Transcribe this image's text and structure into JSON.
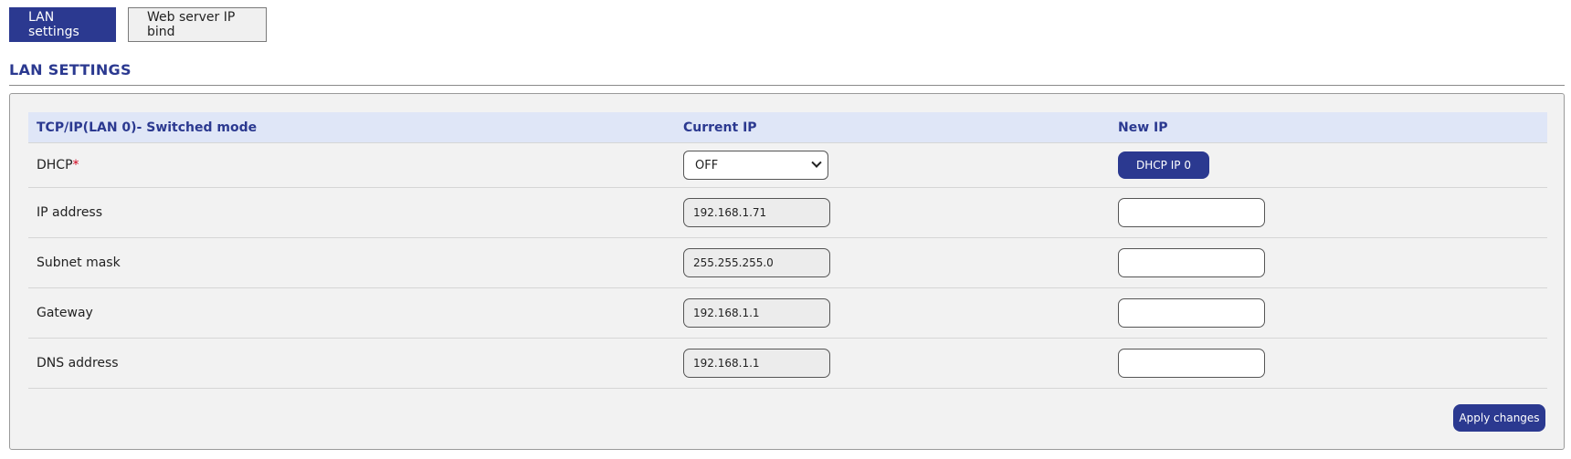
{
  "tabs": [
    {
      "label": "LAN settings",
      "active": true
    },
    {
      "label": "Web server IP bind",
      "active": false
    }
  ],
  "section_title": "LAN SETTINGS",
  "table": {
    "headers": {
      "col1": "TCP/IP(LAN 0)- Switched mode",
      "col2": "Current IP",
      "col3": "New IP"
    },
    "dhcp": {
      "label": "DHCP",
      "required_mark": "*",
      "current_value": "OFF",
      "button_label": "DHCP IP 0"
    },
    "rows": [
      {
        "label": "IP address",
        "current": "192.168.1.71",
        "new": ""
      },
      {
        "label": "Subnet mask",
        "current": "255.255.255.0",
        "new": ""
      },
      {
        "label": "Gateway",
        "current": "192.168.1.1",
        "new": ""
      },
      {
        "label": "DNS address",
        "current": "192.168.1.1",
        "new": ""
      }
    ]
  },
  "apply_label": "Apply changes",
  "colors": {
    "accent": "#2b3990",
    "header_bg": "#dfe6f7",
    "panel_bg": "#f2f2f2",
    "required": "#d0021b"
  }
}
